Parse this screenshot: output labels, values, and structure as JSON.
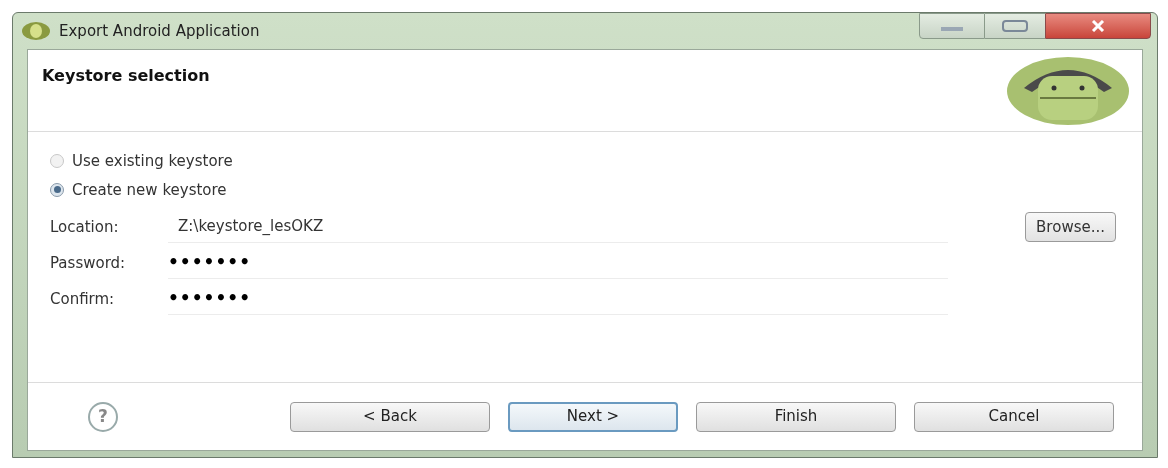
{
  "window": {
    "title": "Export Android Application"
  },
  "page": {
    "title": "Keystore selection"
  },
  "options": [
    {
      "label": "Use existing keystore",
      "selected": false
    },
    {
      "label": "Create new keystore",
      "selected": true
    }
  ],
  "fields": [
    {
      "label": "Location:",
      "value": "Z:\\keystore_lesOKZ",
      "kind": "text"
    },
    {
      "label": "Password:",
      "value": "•••••••",
      "kind": "password"
    },
    {
      "label": "Confirm:",
      "value": "•••••••",
      "kind": "password"
    }
  ],
  "browse_button": "Browse...",
  "help_button": "?",
  "buttons": [
    {
      "label": "< Back",
      "default": false
    },
    {
      "label": "Next >",
      "default": true
    },
    {
      "label": "Finish",
      "default": false
    },
    {
      "label": "Cancel",
      "default": false
    }
  ]
}
